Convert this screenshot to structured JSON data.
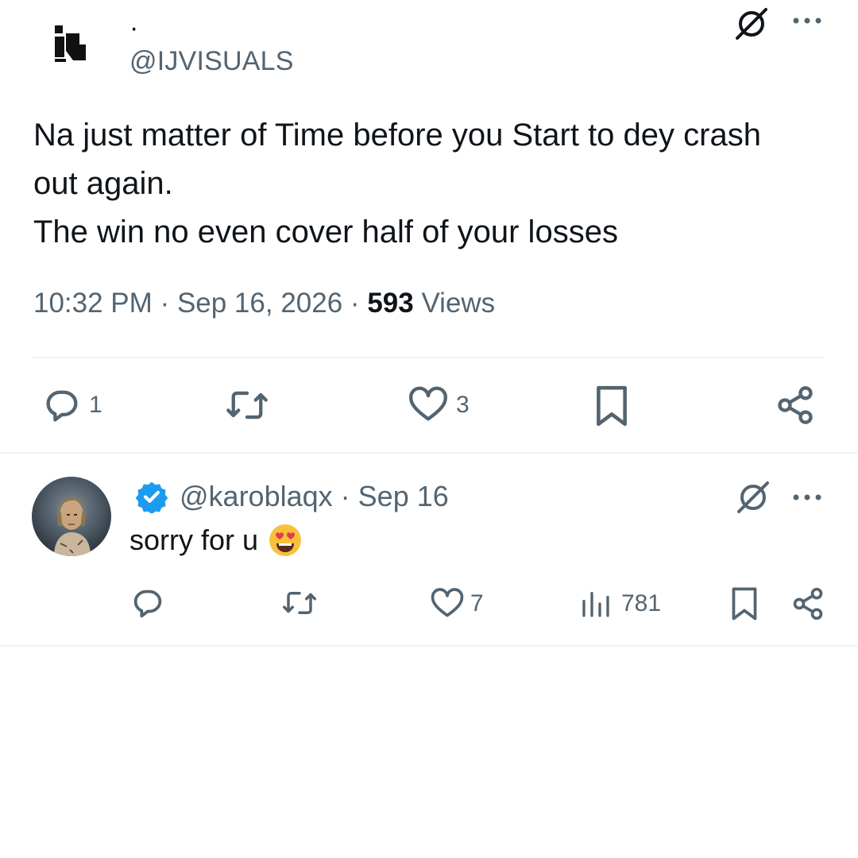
{
  "post": {
    "display_name": "·",
    "handle": "@IJVISUALS",
    "text_lines": [
      "Na just matter of Time before you Start to dey crash",
      "out again.",
      "The win no even cover half of your losses"
    ],
    "time": "10:32 PM",
    "date": "Sep 16, 2026",
    "views_count": "593",
    "views_label": "Views",
    "actions": {
      "reply_count": "1",
      "repost_count": "",
      "like_count": "3"
    }
  },
  "reply": {
    "handle": "@karoblaqx",
    "date": "Sep 16",
    "text": "sorry for u",
    "emoji": "heart-eyes-emoji",
    "actions": {
      "reply_count": "",
      "repost_count": "",
      "like_count": "7",
      "views_count": "781"
    }
  },
  "icons": {
    "reply": "speech-bubble-icon",
    "repost": "repost-icon",
    "like": "heart-icon",
    "bookmark": "bookmark-icon",
    "share": "share-icon",
    "views": "bar-chart-icon",
    "grok": "grok-icon",
    "more": "more-dots-icon",
    "verified": "verified-badge-icon"
  },
  "colors": {
    "text": "#0f1419",
    "secondary": "#536471",
    "verified": "#1d9bf0",
    "divider": "#eff3f4"
  }
}
